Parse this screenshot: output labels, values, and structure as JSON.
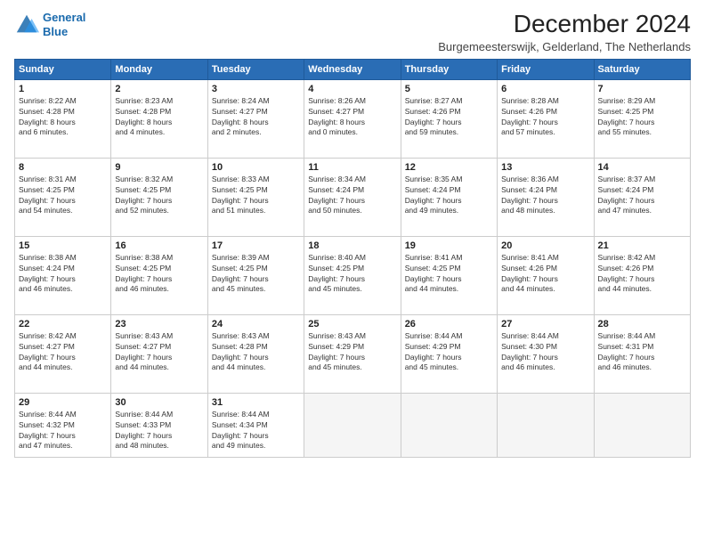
{
  "logo": {
    "line1": "General",
    "line2": "Blue"
  },
  "title": "December 2024",
  "subtitle": "Burgemeesterswijk, Gelderland, The Netherlands",
  "header_days": [
    "Sunday",
    "Monday",
    "Tuesday",
    "Wednesday",
    "Thursday",
    "Friday",
    "Saturday"
  ],
  "weeks": [
    [
      {
        "day": "1",
        "sunrise": "8:22 AM",
        "sunset": "4:28 PM",
        "daylight": "8 hours and 6 minutes."
      },
      {
        "day": "2",
        "sunrise": "8:23 AM",
        "sunset": "4:28 PM",
        "daylight": "8 hours and 4 minutes."
      },
      {
        "day": "3",
        "sunrise": "8:24 AM",
        "sunset": "4:27 PM",
        "daylight": "8 hours and 2 minutes."
      },
      {
        "day": "4",
        "sunrise": "8:26 AM",
        "sunset": "4:27 PM",
        "daylight": "8 hours and 0 minutes."
      },
      {
        "day": "5",
        "sunrise": "8:27 AM",
        "sunset": "4:26 PM",
        "daylight": "7 hours and 59 minutes."
      },
      {
        "day": "6",
        "sunrise": "8:28 AM",
        "sunset": "4:26 PM",
        "daylight": "7 hours and 57 minutes."
      },
      {
        "day": "7",
        "sunrise": "8:29 AM",
        "sunset": "4:25 PM",
        "daylight": "7 hours and 55 minutes."
      }
    ],
    [
      {
        "day": "8",
        "sunrise": "8:31 AM",
        "sunset": "4:25 PM",
        "daylight": "7 hours and 54 minutes."
      },
      {
        "day": "9",
        "sunrise": "8:32 AM",
        "sunset": "4:25 PM",
        "daylight": "7 hours and 52 minutes."
      },
      {
        "day": "10",
        "sunrise": "8:33 AM",
        "sunset": "4:25 PM",
        "daylight": "7 hours and 51 minutes."
      },
      {
        "day": "11",
        "sunrise": "8:34 AM",
        "sunset": "4:24 PM",
        "daylight": "7 hours and 50 minutes."
      },
      {
        "day": "12",
        "sunrise": "8:35 AM",
        "sunset": "4:24 PM",
        "daylight": "7 hours and 49 minutes."
      },
      {
        "day": "13",
        "sunrise": "8:36 AM",
        "sunset": "4:24 PM",
        "daylight": "7 hours and 48 minutes."
      },
      {
        "day": "14",
        "sunrise": "8:37 AM",
        "sunset": "4:24 PM",
        "daylight": "7 hours and 47 minutes."
      }
    ],
    [
      {
        "day": "15",
        "sunrise": "8:38 AM",
        "sunset": "4:24 PM",
        "daylight": "7 hours and 46 minutes."
      },
      {
        "day": "16",
        "sunrise": "8:38 AM",
        "sunset": "4:25 PM",
        "daylight": "7 hours and 46 minutes."
      },
      {
        "day": "17",
        "sunrise": "8:39 AM",
        "sunset": "4:25 PM",
        "daylight": "7 hours and 45 minutes."
      },
      {
        "day": "18",
        "sunrise": "8:40 AM",
        "sunset": "4:25 PM",
        "daylight": "7 hours and 45 minutes."
      },
      {
        "day": "19",
        "sunrise": "8:41 AM",
        "sunset": "4:25 PM",
        "daylight": "7 hours and 44 minutes."
      },
      {
        "day": "20",
        "sunrise": "8:41 AM",
        "sunset": "4:26 PM",
        "daylight": "7 hours and 44 minutes."
      },
      {
        "day": "21",
        "sunrise": "8:42 AM",
        "sunset": "4:26 PM",
        "daylight": "7 hours and 44 minutes."
      }
    ],
    [
      {
        "day": "22",
        "sunrise": "8:42 AM",
        "sunset": "4:27 PM",
        "daylight": "7 hours and 44 minutes."
      },
      {
        "day": "23",
        "sunrise": "8:43 AM",
        "sunset": "4:27 PM",
        "daylight": "7 hours and 44 minutes."
      },
      {
        "day": "24",
        "sunrise": "8:43 AM",
        "sunset": "4:28 PM",
        "daylight": "7 hours and 44 minutes."
      },
      {
        "day": "25",
        "sunrise": "8:43 AM",
        "sunset": "4:29 PM",
        "daylight": "7 hours and 45 minutes."
      },
      {
        "day": "26",
        "sunrise": "8:44 AM",
        "sunset": "4:29 PM",
        "daylight": "7 hours and 45 minutes."
      },
      {
        "day": "27",
        "sunrise": "8:44 AM",
        "sunset": "4:30 PM",
        "daylight": "7 hours and 46 minutes."
      },
      {
        "day": "28",
        "sunrise": "8:44 AM",
        "sunset": "4:31 PM",
        "daylight": "7 hours and 46 minutes."
      }
    ],
    [
      {
        "day": "29",
        "sunrise": "8:44 AM",
        "sunset": "4:32 PM",
        "daylight": "7 hours and 47 minutes."
      },
      {
        "day": "30",
        "sunrise": "8:44 AM",
        "sunset": "4:33 PM",
        "daylight": "7 hours and 48 minutes."
      },
      {
        "day": "31",
        "sunrise": "8:44 AM",
        "sunset": "4:34 PM",
        "daylight": "7 hours and 49 minutes."
      },
      null,
      null,
      null,
      null
    ]
  ]
}
